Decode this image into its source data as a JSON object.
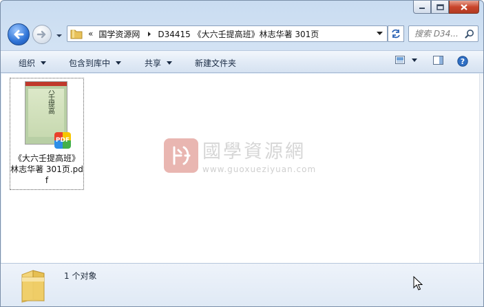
{
  "window": {
    "caption_buttons": [
      "minimize-icon",
      "maximize-icon",
      "close-icon"
    ]
  },
  "nav": {
    "back_icon": "back-arrow-icon",
    "forward_icon": "forward-arrow-icon"
  },
  "address": {
    "overflow": "«",
    "segments": [
      "国学资源网",
      "D34415 《大六壬提高班》林志华著 301页"
    ]
  },
  "search": {
    "placeholder": "搜索 D34..."
  },
  "toolbar": {
    "organize": "组织",
    "include_library": "包含到库中",
    "share": "共享",
    "new_folder": "新建文件夹"
  },
  "files": [
    {
      "name": "《大六壬提高班》林志华著 301页.pdf",
      "badge": "PDF",
      "cover_text": "大六壬提高"
    }
  ],
  "watermark": {
    "cn": "國學資源網",
    "url": "www.guoxueziyuan.com"
  },
  "details": {
    "count": "1 个对象"
  },
  "colors": {
    "window_frame": "#c9dcf1",
    "toolbar": "#e2ebf6",
    "close_button": "#c9452c"
  }
}
